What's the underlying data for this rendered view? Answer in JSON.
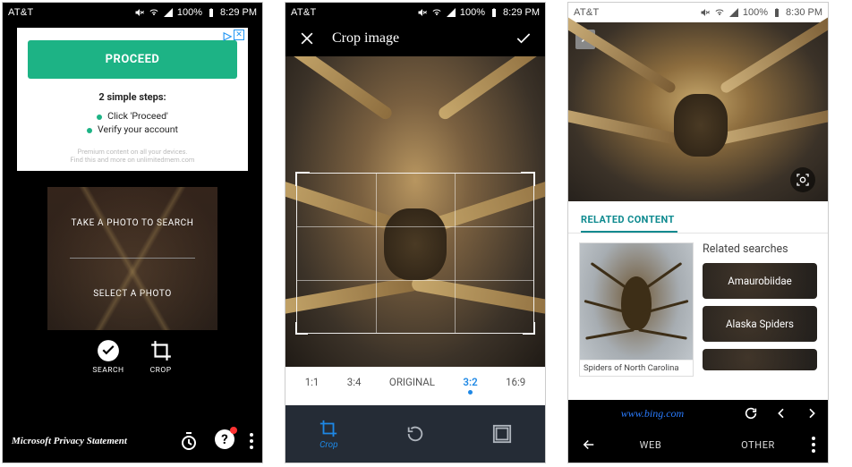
{
  "status": {
    "carrier": "AT&T",
    "battery": "100%",
    "time1": "8:29 PM",
    "time2": "8:29 PM",
    "time3": "8:30 PM"
  },
  "phone1": {
    "ad": {
      "proceed": "PROCEED",
      "steps_title": "2 simple steps:",
      "step1": "Click 'Proceed'",
      "step2": "Verify your account",
      "footer1": "Premium content on all your devices.",
      "footer2": "Find this and more on unlimitedmem.com"
    },
    "panel": {
      "take": "TAKE A PHOTO TO SEARCH",
      "select": "SELECT A PHOTO"
    },
    "icons": {
      "search": "SEARCH",
      "crop": "CROP"
    },
    "privacy": "Microsoft Privacy Statement"
  },
  "phone2": {
    "title": "Crop image",
    "ratios": {
      "r1": "1:1",
      "r2": "3:4",
      "r3": "ORIGINAL",
      "r4": "3:2",
      "r5": "16:9"
    },
    "tab_crop": "Crop"
  },
  "phone3": {
    "tab": "RELATED CONTENT",
    "result_caption": "Spiders of North Carolina",
    "related_title": "Related searches",
    "chip1": "Amaurobiidae",
    "chip2": "Alaska Spiders",
    "url": "www.bing.com",
    "nav_web": "WEB",
    "nav_other": "OTHER"
  }
}
